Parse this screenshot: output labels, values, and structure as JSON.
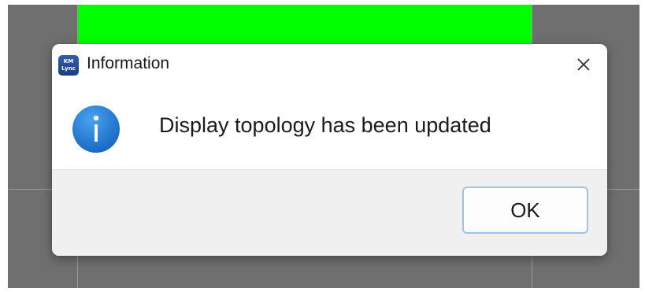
{
  "dialog": {
    "title": "Information",
    "app_icon": {
      "name": "kmlync-app-icon",
      "line1": "KM",
      "line2": "Lync"
    },
    "close_icon": "close-icon",
    "message": "Display topology has been updated",
    "info_icon": "info-icon",
    "ok_label": "OK"
  },
  "colors": {
    "background": "#6f6f6f",
    "green_panel": "#00ff00",
    "info_blue": "#1e78d4",
    "ok_border": "#9dc3e6"
  }
}
